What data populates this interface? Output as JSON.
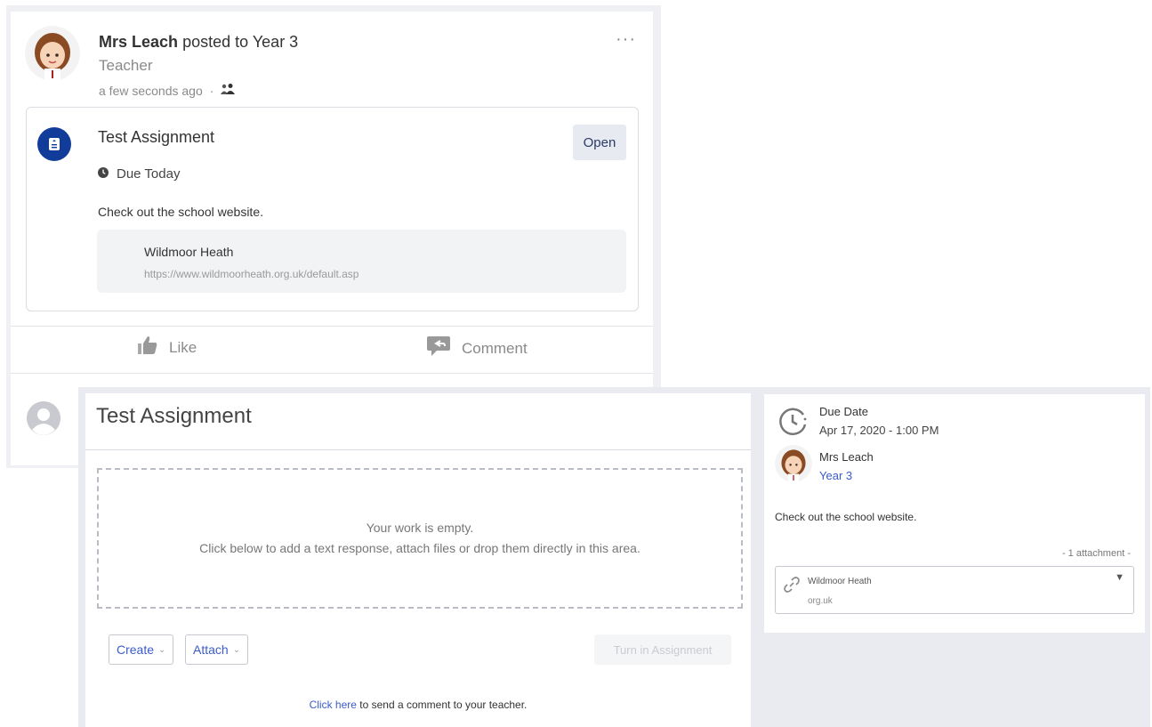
{
  "post": {
    "author": "Mrs Leach",
    "posted_to_text": "posted to",
    "class_name": "Year 3",
    "role": "Teacher",
    "time": "a few seconds ago",
    "time_separator": "·",
    "more": "···",
    "assignment": {
      "title": "Test Assignment",
      "open_label": "Open",
      "due": "Due Today",
      "description": "Check out the school website.",
      "link": {
        "title": "Wildmoor Heath",
        "url": "https://www.wildmoorheath.org.uk/default.asp"
      }
    },
    "actions": {
      "like_label": "Like",
      "comment_label": "Comment"
    }
  },
  "detail": {
    "title": "Test Assignment",
    "empty_line1": "Your work is empty.",
    "empty_line2": "Click below to add a text response, attach files or drop them directly in this area.",
    "create_label": "Create",
    "attach_label": "Attach",
    "turn_in_label": "Turn in Assignment",
    "comment_link": "Click here",
    "comment_rest": " to send a comment to your teacher."
  },
  "sidebar": {
    "due_label": "Due Date",
    "due_value": "Apr 17, 2020 - 1:00 PM",
    "teacher_name": "Mrs Leach",
    "teacher_class": "Year 3",
    "description": "Check out the school website.",
    "attachment_count": "- 1 attachment -",
    "attachment_name": "Wildmoor Heath",
    "attachment_url": "org.uk"
  },
  "colors": {
    "accent": "#3b5bcb",
    "assignment_icon": "#123c9a",
    "panel_bg": "#e9ebf0"
  },
  "icons": [
    "more-options-icon",
    "assignment-icon",
    "clock-icon",
    "thumbs-up-icon",
    "comment-icon",
    "user-placeholder-icon",
    "link-icon",
    "chevron-down-icon",
    "group-icon"
  ]
}
